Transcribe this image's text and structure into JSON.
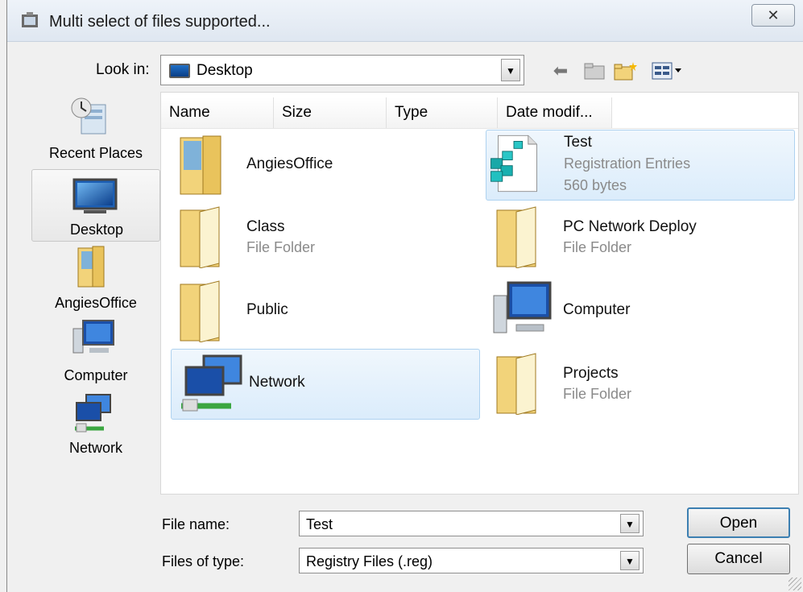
{
  "window": {
    "title": "Multi select of files supported...",
    "close_glyph": "✕"
  },
  "lookin": {
    "label": "Look in:",
    "value": "Desktop"
  },
  "places": [
    {
      "label": "Recent Places",
      "icon": "recent-places-icon"
    },
    {
      "label": "Desktop",
      "icon": "desktop-icon",
      "selected": true
    },
    {
      "label": "AngiesOffice",
      "icon": "user-folder-icon"
    },
    {
      "label": "Computer",
      "icon": "computer-icon"
    },
    {
      "label": "Network",
      "icon": "network-icon"
    }
  ],
  "columns": [
    "Name",
    "Size",
    "Type",
    "Date modif..."
  ],
  "items": [
    {
      "name": "AngiesOffice",
      "sub1": "",
      "sub2": "",
      "icon": "user-folder-icon"
    },
    {
      "name": "Test",
      "sub1": "Registration Entries",
      "sub2": "560 bytes",
      "icon": "registry-file-icon",
      "selected": true
    },
    {
      "name": "Class",
      "sub1": "File Folder",
      "sub2": "",
      "icon": "folder-icon"
    },
    {
      "name": "PC Network Deploy",
      "sub1": "File Folder",
      "sub2": "",
      "icon": "folder-icon"
    },
    {
      "name": "Public",
      "sub1": "",
      "sub2": "",
      "icon": "folder-icon"
    },
    {
      "name": "Computer",
      "sub1": "",
      "sub2": "",
      "icon": "computer-icon"
    },
    {
      "name": "Network",
      "sub1": "",
      "sub2": "",
      "icon": "network-icon",
      "selected": true
    },
    {
      "name": "Projects",
      "sub1": "File Folder",
      "sub2": "",
      "icon": "folder-icon"
    }
  ],
  "filename": {
    "label": "File name:",
    "value": "Test"
  },
  "filetype": {
    "label": "Files of type:",
    "value": "Registry Files (.reg)"
  },
  "buttons": {
    "open": "Open",
    "cancel": "Cancel"
  },
  "colors": {
    "selection_bg": "#dbecfb",
    "selection_border": "#aed2f0",
    "folder": "#f2d37a"
  }
}
